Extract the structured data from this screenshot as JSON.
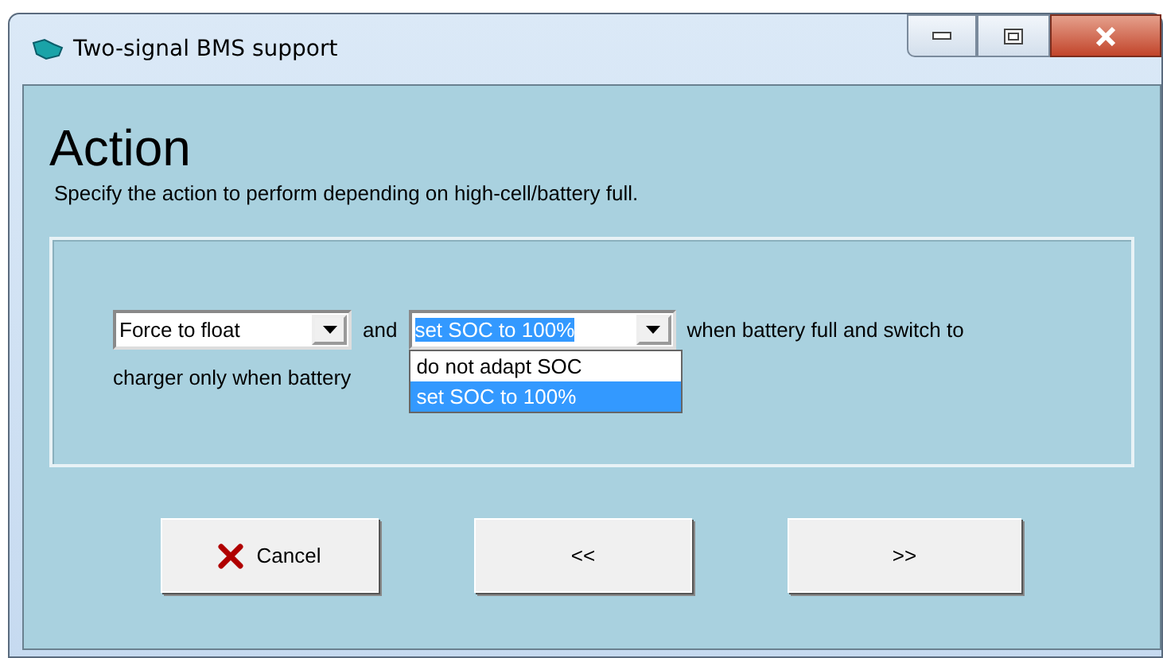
{
  "window": {
    "title": "Two-signal BMS support"
  },
  "heading": "Action",
  "description": "Specify the action to perform depending on high-cell/battery full.",
  "sentence": {
    "mode_combo": {
      "value": "Force to float"
    },
    "joiner": "and",
    "soc_combo": {
      "value": "set SOC to 100%",
      "expanded": true,
      "options": [
        {
          "label": "do not adapt SOC",
          "selected": false
        },
        {
          "label": "set SOC to 100%",
          "selected": true
        }
      ]
    },
    "after": "when battery full and switch to",
    "line_2": "charger only when battery"
  },
  "buttons": [
    {
      "kind": "cancel",
      "label": "Cancel"
    },
    {
      "kind": "plain",
      "label": "<<"
    },
    {
      "kind": "plain",
      "label": ">>"
    }
  ]
}
